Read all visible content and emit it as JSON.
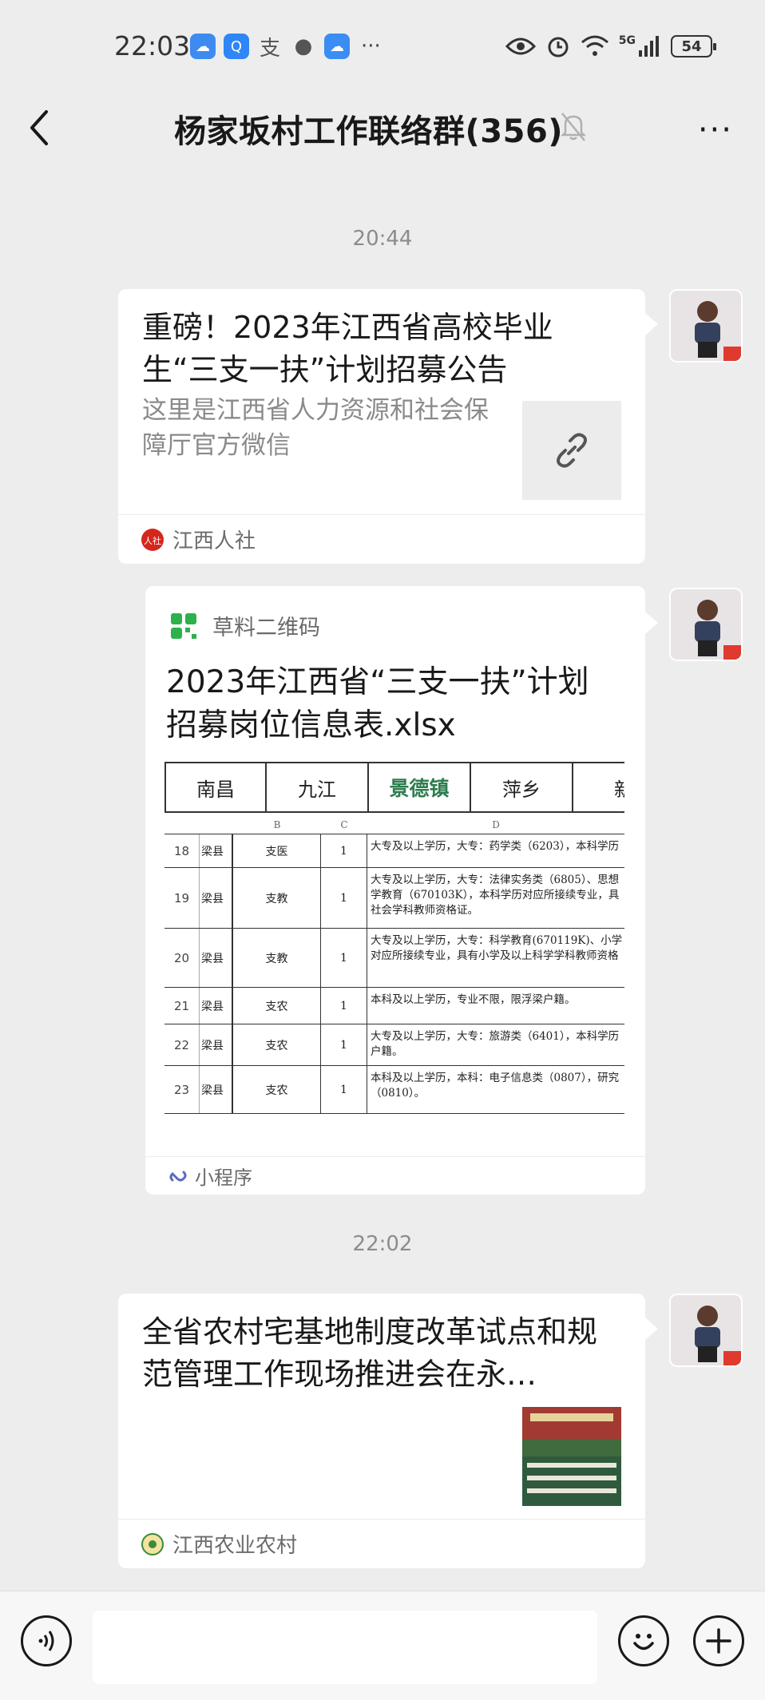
{
  "status_bar": {
    "time": "22:03",
    "app_icons": [
      "weather-icon",
      "search-app-icon",
      "alipay-icon",
      "message-icon",
      "cloud-icon"
    ],
    "more": "···",
    "network": "5G",
    "battery": "54"
  },
  "header": {
    "title": "杨家坂村工作联络群(356)",
    "more": "···"
  },
  "messages": [
    {
      "timestamp": "20:44",
      "title": "重磅！2023年江西省高校毕业生“三支一扶”计划招募公告",
      "description": "这里是江西省人力资源和社会保障厅官方微信",
      "source": "江西人社"
    },
    {
      "app": "草料二维码",
      "title": "2023年江西省“三支一扶”计划招募岗位信息表.xlsx",
      "footer": "小程序",
      "sheet": {
        "tabs": [
          "南昌",
          "九江",
          "景德镇",
          "萍乡",
          "新"
        ],
        "columns": [
          "B",
          "C",
          "D"
        ],
        "rows": [
          {
            "no": "18",
            "county": "梁县",
            "type": "支医",
            "count": "1",
            "lines": [
              "大专及以上学历，大专：药学类（6203），本科学历"
            ]
          },
          {
            "no": "19",
            "county": "梁县",
            "type": "支教",
            "count": "1",
            "lines": [
              "大专及以上学历，大专：法律实务类（6805）、思想",
              "学教育（670103K），本科学历对应所接续专业，具",
              "社会学科教师资格证。"
            ]
          },
          {
            "no": "20",
            "county": "梁县",
            "type": "支教",
            "count": "1",
            "lines": [
              "大专及以上学历，大专：科学教育(670119K)、小学",
              "对应所接续专业，具有小学及以上科学学科教师资格"
            ]
          },
          {
            "no": "21",
            "county": "梁县",
            "type": "支农",
            "count": "1",
            "lines": [
              "本科及以上学历，专业不限，限浮梁户籍。"
            ]
          },
          {
            "no": "22",
            "county": "梁县",
            "type": "支农",
            "count": "1",
            "lines": [
              "大专及以上学历，大专：旅游类（6401），本科学历",
              "户籍。"
            ]
          },
          {
            "no": "23",
            "county": "梁县",
            "type": "支农",
            "count": "1",
            "lines": [
              "本科及以上学历，本科：电子信息类（0807），研究",
              "（0810）。"
            ]
          }
        ]
      }
    },
    {
      "timestamp": "22:02",
      "title": "全省农村宅基地制度改革试点和规范管理工作现场推进会在永…",
      "source": "江西农业农村"
    }
  ],
  "colors": {
    "background": "#ededed",
    "card": "#ffffff",
    "accent_green": "#2e7d4f",
    "link_icon_bg": "#ececec"
  }
}
